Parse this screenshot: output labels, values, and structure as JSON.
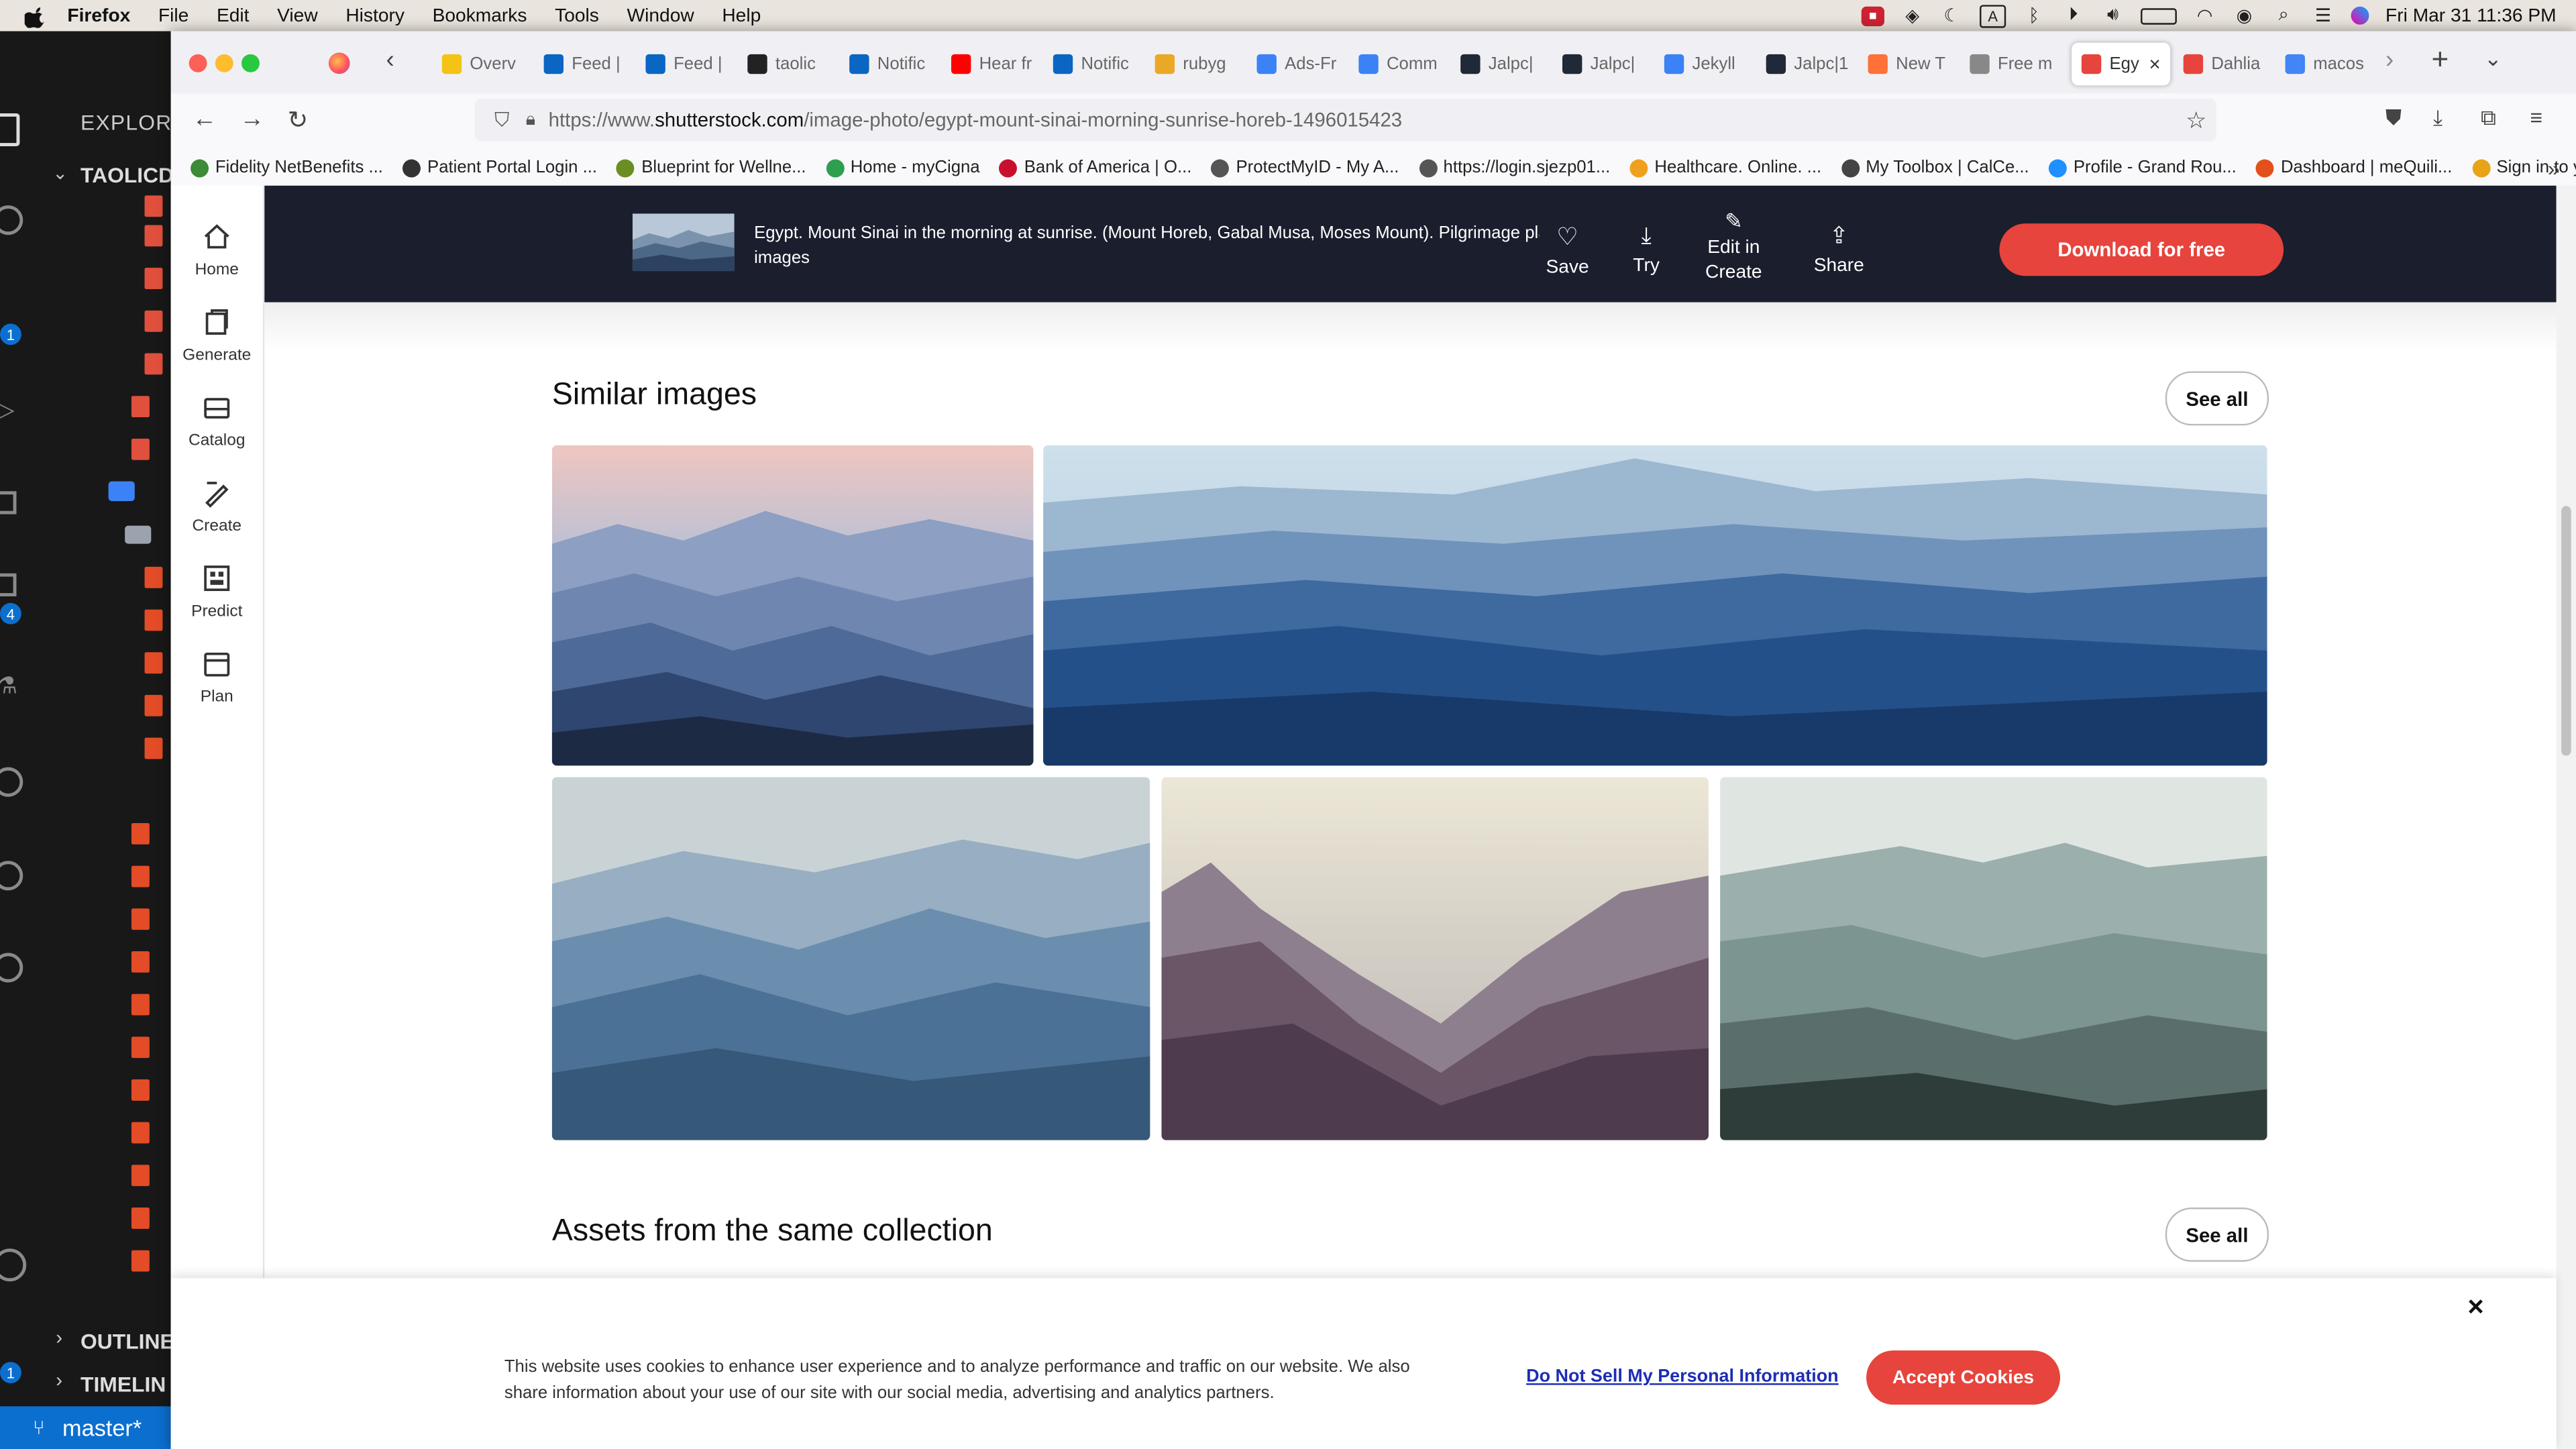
{
  "menubar": {
    "app": "Firefox",
    "items": [
      "File",
      "Edit",
      "View",
      "History",
      "Bookmarks",
      "Tools",
      "Window",
      "Help"
    ],
    "clock": "Fri Mar 31  11:36 PM"
  },
  "vscode": {
    "explorer": "EXPLORE",
    "folder": "TAOLICD",
    "outline": "OUTLINE",
    "timeline": "TIMELIN",
    "branch": "master*",
    "badges": [
      "1",
      "4",
      "1"
    ]
  },
  "tabs": [
    {
      "label": "Overv",
      "color": "#f3c316"
    },
    {
      "label": "Feed |",
      "color": "#0a66c2"
    },
    {
      "label": "Feed |",
      "color": "#0a66c2"
    },
    {
      "label": "taolic",
      "color": "#222222"
    },
    {
      "label": "Notific",
      "color": "#0a66c2"
    },
    {
      "label": "Hear fr",
      "color": "#ff0000"
    },
    {
      "label": "Notific",
      "color": "#0a66c2"
    },
    {
      "label": "rubyg",
      "color": "#e9a825"
    },
    {
      "label": "Ads-Fr",
      "color": "#3b82f6"
    },
    {
      "label": "Comm",
      "color": "#3b82f6"
    },
    {
      "label": "Jalpc|",
      "color": "#1f2937"
    },
    {
      "label": "Jalpc|",
      "color": "#1f2937"
    },
    {
      "label": "Jekyll",
      "color": "#3b82f6"
    },
    {
      "label": "Jalpc|1",
      "color": "#1f2937"
    },
    {
      "label": "New T",
      "color": "#ff7139"
    },
    {
      "label": "Free m",
      "color": "#888888"
    },
    {
      "label": "Egy",
      "color": "#e6443c"
    },
    {
      "label": "Dahlia",
      "color": "#e6443c"
    },
    {
      "label": "macos",
      "color": "#4285f4"
    }
  ],
  "url": {
    "prefix": "https://www.",
    "host": "shutterstock.com",
    "path": "/image-photo/egypt-mount-sinai-morning-sunrise-horeb-1496015423"
  },
  "bookmarks": [
    {
      "label": "Fidelity NetBenefits ...",
      "color": "#3d8b37"
    },
    {
      "label": "Patient Portal Login ...",
      "color": "#333333"
    },
    {
      "label": "Blueprint for Wellne...",
      "color": "#6b8e23"
    },
    {
      "label": "Home - myCigna",
      "color": "#2e9e4f"
    },
    {
      "label": "Bank of America | O...",
      "color": "#c8102e"
    },
    {
      "label": "ProtectMyID - My A...",
      "color": "#555555"
    },
    {
      "label": "https://login.sjezp01...",
      "color": "#555555"
    },
    {
      "label": "Healthcare. Online. ...",
      "color": "#f0a020"
    },
    {
      "label": "My Toolbox | CalCe...",
      "color": "#444444"
    },
    {
      "label": "Profile - Grand Rou...",
      "color": "#1e90ff"
    },
    {
      "label": "Dashboard | meQuili...",
      "color": "#e2501c"
    },
    {
      "label": "Sign in to your Optu...",
      "color": "#e8a317"
    }
  ],
  "leftnav": [
    "Home",
    "Generate",
    "Catalog",
    "Create",
    "Predict",
    "Plan"
  ],
  "header": {
    "caption": "Egypt. Mount Sinai in the morning at sunrise. (Mount Horeb, Gabal Musa, Moses Mount). Pilgrimage plac",
    "subcaption": "images",
    "save": "Save",
    "try": "Try",
    "edit1": "Edit in",
    "edit2": "Create",
    "share": "Share",
    "download": "Download for free"
  },
  "similar": {
    "title": "Similar images",
    "see_all": "See all"
  },
  "collection": {
    "title": "Assets from the same collection",
    "see_all": "See all"
  },
  "cookie": {
    "text": "This website uses cookies to enhance user experience and to analyze performance and traffic on our website. We also share information about your use of our site with our social media, advertising and analytics partners.",
    "dns": "Do Not Sell My Personal Information",
    "accept": "Accept Cookies",
    "close": "×"
  }
}
